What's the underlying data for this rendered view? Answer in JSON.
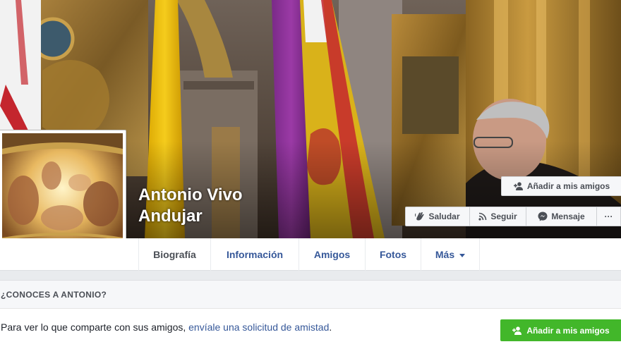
{
  "profile": {
    "name_line1": "Antonio Vivo",
    "name_line2": "Andujar"
  },
  "cover_actions": {
    "add_friend": "Añadir a mis amigos",
    "greet": "Saludar",
    "follow": "Seguir",
    "message": "Mensaje",
    "more": "···"
  },
  "tabs": [
    {
      "label": "Biografía",
      "active": true
    },
    {
      "label": "Información"
    },
    {
      "label": "Amigos"
    },
    {
      "label": "Fotos"
    },
    {
      "label": "Más"
    }
  ],
  "know": {
    "header": "¿CONOCES A ANTONIO?",
    "text_prefix": "Para ver lo que comparte con sus amigos, ",
    "link_text": "envíale una solicitud de amistad",
    "text_suffix": ".",
    "add_friend": "Añadir a mis amigos"
  },
  "icons": {
    "add_friend": "person-plus-icon",
    "greet": "waving-hand-icon",
    "follow": "rss-icon",
    "message": "messenger-icon",
    "more": "ellipsis-icon",
    "more_tab": "caret-down-icon"
  },
  "colors": {
    "link_blue": "#365899",
    "green_button": "#42b72a",
    "background": "#e9ebee"
  }
}
